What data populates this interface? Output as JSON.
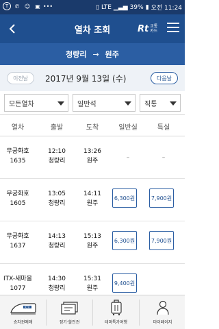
{
  "status_bar": {
    "left_icons": [
      "chat-bubble-icon",
      "phone-icon",
      "smile-icon",
      "box-icon",
      "dots-icon"
    ],
    "lte": "LTE",
    "battery": "39%",
    "time": "오전 11:24"
  },
  "header": {
    "title": "열차 조회",
    "rt_big": "Rt",
    "rt_small_1": "교통",
    "rt_small_2": "카드"
  },
  "route": {
    "from": "청량리",
    "arrow": "→",
    "to": "원주"
  },
  "date_bar": {
    "prev_label": "이전날",
    "date": "2017년 9월 13일 (수)",
    "next_label": "다음날"
  },
  "filters": {
    "train_type": "모든열차",
    "seat_type": "일반석",
    "route_type": "직통"
  },
  "table": {
    "headers": [
      "열차",
      "출발",
      "도착",
      "일반실",
      "특실"
    ],
    "rows": [
      {
        "train_name": "무궁화호",
        "train_no": "1635",
        "dep_time": "12:10",
        "dep_station": "청량리",
        "arr_time": "13:26",
        "arr_station": "원주",
        "general": "–",
        "special": "–"
      },
      {
        "train_name": "무궁화호",
        "train_no": "1605",
        "dep_time": "13:05",
        "dep_station": "청량리",
        "arr_time": "14:11",
        "arr_station": "원주",
        "general": "6,300원",
        "special": "7,900원"
      },
      {
        "train_name": "무궁화호",
        "train_no": "1637",
        "dep_time": "14:13",
        "dep_station": "청량리",
        "arr_time": "15:13",
        "arr_station": "원주",
        "general": "6,300원",
        "special": "7,900원"
      },
      {
        "train_name": "ITX-새마을",
        "train_no": "1077",
        "dep_time": "14:30",
        "dep_station": "청량리",
        "arr_time": "15:31",
        "arr_station": "원주",
        "general": "9,400원",
        "special": ""
      }
    ]
  },
  "tab_bar": {
    "tabs": [
      {
        "label": "승차권예매",
        "icon": "ktx-train-icon"
      },
      {
        "label": "정기·할인권",
        "icon": "tickets-icon"
      },
      {
        "label": "테마특가여행",
        "icon": "luggage-icon"
      },
      {
        "label": "마이페이지",
        "icon": "person-icon"
      }
    ]
  },
  "colors": {
    "statusbar": "#1a3a6b",
    "header": "#1f4f8f",
    "route": "#2b5ea3",
    "datebar": "#eef2f7"
  }
}
